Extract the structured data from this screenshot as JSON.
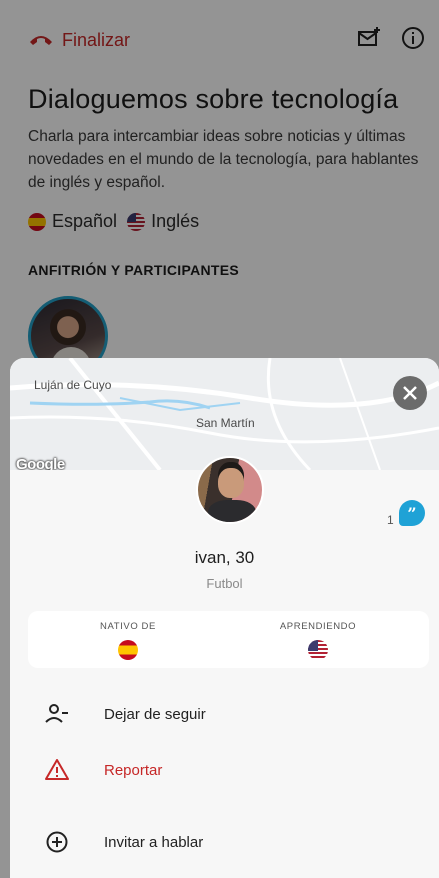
{
  "room": {
    "end_call_label": "Finalizar",
    "title": "Dialoguemos sobre tecnología",
    "description": "Charla para intercambiar ideas sobre noticias y últimas novedades en el mundo de la tecnología, para hablantes de inglés y español.",
    "languages": [
      {
        "name": "Español",
        "flag": "spain-flag"
      },
      {
        "name": "Inglés",
        "flag": "usa-flag"
      }
    ],
    "participants_header": "ANFITRIÓN Y PARTICIPANTES",
    "icons": [
      "end-call-icon",
      "invite-mail-icon",
      "info-icon"
    ],
    "accent_color": "#c62828"
  },
  "profile_sheet": {
    "map": {
      "labels": [
        "Luján de Cuyo",
        "San Martín"
      ],
      "attribution": "Google"
    },
    "user": {
      "name_age": "ivan, 30",
      "interest": "Futbol",
      "message_count": "1"
    },
    "languages": {
      "native_label": "NATIVO DE",
      "native_flag": "spain-flag",
      "learning_label": "APRENDIENDO",
      "learning_flag": "usa-flag"
    },
    "actions": [
      {
        "label": "Dejar de seguir",
        "icon": "unfollow-user-icon"
      },
      {
        "label": "Reportar",
        "icon": "warning-triangle-icon",
        "color": "#c62828"
      },
      {
        "label": "Invitar a hablar",
        "icon": "add-circle-icon"
      }
    ],
    "badge_color": "#1fa2d6"
  }
}
